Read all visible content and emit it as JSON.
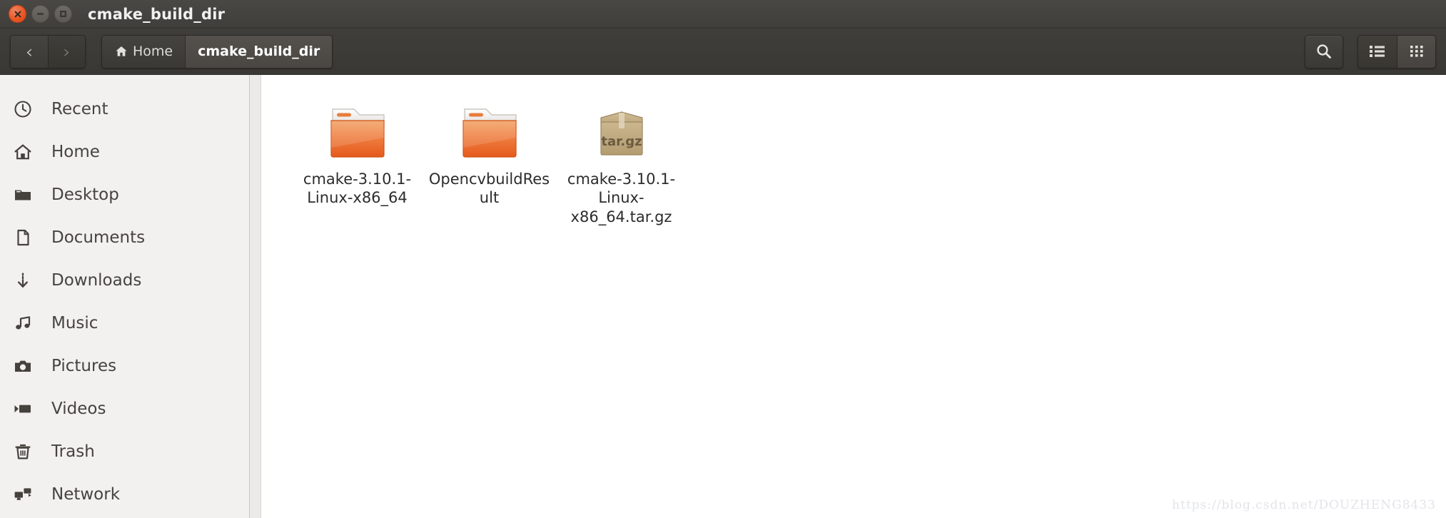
{
  "window": {
    "title": "cmake_build_dir",
    "controls": [
      {
        "name": "close",
        "glyph": "close-icon"
      },
      {
        "name": "minimize",
        "glyph": "minimize-icon"
      },
      {
        "name": "maximize",
        "glyph": "maximize-icon"
      }
    ]
  },
  "toolbar": {
    "back_label": "‹",
    "forward_label": "›",
    "breadcrumbs": [
      {
        "label": "Home",
        "icon": "home-icon",
        "active": false
      },
      {
        "label": "cmake_build_dir",
        "icon": "",
        "active": true
      }
    ],
    "search_icon": "search-icon",
    "list_view_icon": "list-view-icon",
    "grid_view_icon": "grid-view-icon"
  },
  "sidebar": {
    "items": [
      {
        "label": "Recent",
        "icon": "clock-icon"
      },
      {
        "label": "Home",
        "icon": "home-icon"
      },
      {
        "label": "Desktop",
        "icon": "folder-icon"
      },
      {
        "label": "Documents",
        "icon": "document-icon"
      },
      {
        "label": "Downloads",
        "icon": "download-icon"
      },
      {
        "label": "Music",
        "icon": "music-note-icon"
      },
      {
        "label": "Pictures",
        "icon": "camera-icon"
      },
      {
        "label": "Videos",
        "icon": "video-icon"
      },
      {
        "label": "Trash",
        "icon": "trash-icon"
      },
      {
        "label": "Network",
        "icon": "network-icon"
      }
    ]
  },
  "content": {
    "items": [
      {
        "label": "cmake-3.10.1-Linux-x86_64",
        "type": "folder"
      },
      {
        "label": "OpencvbuildResult",
        "type": "folder"
      },
      {
        "label": "cmake-3.10.1-Linux-x86_64.tar.gz",
        "type": "archive",
        "badge": "tar.gz"
      }
    ]
  },
  "watermark": {
    "text": "https://blog.csdn.net/DOUZHENG8433"
  },
  "colors": {
    "titlebar": "#403e3a",
    "close_button": "#e95420",
    "sidebar_bg": "#f2f1f0",
    "content_bg": "#ffffff",
    "folder_orange": "#e8622a"
  }
}
